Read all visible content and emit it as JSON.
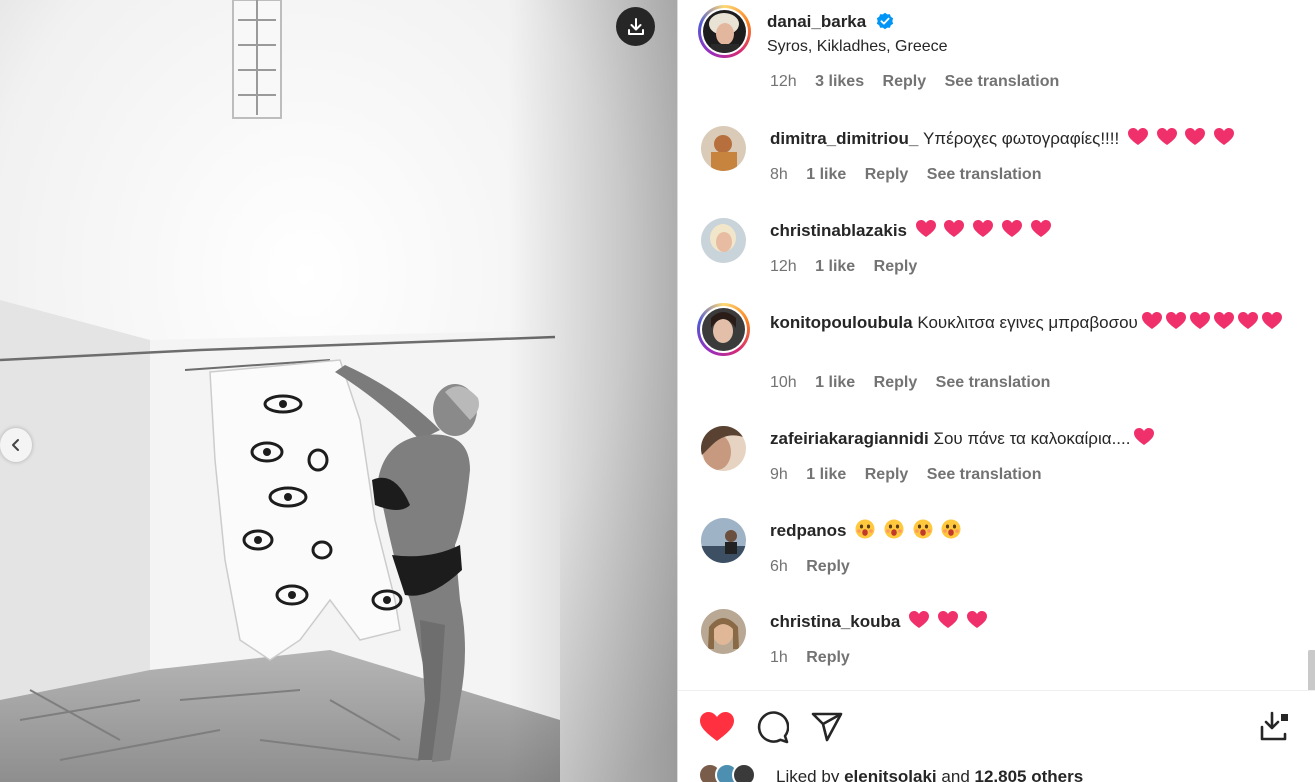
{
  "post": {
    "username": "danai_barka",
    "location": "Syros, Kikladhes, Greece"
  },
  "partial_comment": {
    "time": "12h",
    "likes": "3 likes",
    "reply": "Reply",
    "translate": "See translation"
  },
  "comments": [
    {
      "username": "dimitra_dimitriou_",
      "text": "Υπέροχες φωτογραφίες!!!!",
      "hearts": 4,
      "time": "8h",
      "likes": "1 like",
      "reply": "Reply",
      "translate": "See translation"
    },
    {
      "username": "christinablazakis",
      "text": "",
      "hearts": 5,
      "time": "12h",
      "likes": "1 like",
      "reply": "Reply",
      "translate": ""
    },
    {
      "username": "konitopouloubula",
      "text": "Κουκλιτσα εγινες μπραβοσου",
      "hearts": 6,
      "time": "10h",
      "likes": "1 like",
      "reply": "Reply",
      "translate": "See translation"
    },
    {
      "username": "zafeiriakaragiannidi",
      "text": "Σου πάνε τα καλοκαίρια....",
      "hearts": 1,
      "time": "9h",
      "likes": "1 like",
      "reply": "Reply",
      "translate": "See translation"
    },
    {
      "username": "redpanos",
      "text": "",
      "wow": 4,
      "time": "6h",
      "likes": "",
      "reply": "Reply",
      "translate": ""
    },
    {
      "username": "christina_kouba",
      "text": "",
      "hearts": 3,
      "time": "1h",
      "likes": "",
      "reply": "Reply",
      "translate": ""
    }
  ],
  "likes_summary": {
    "prefix": "Liked by",
    "user": "elenitsolaki",
    "middle": "and",
    "others": "12,805 others"
  },
  "icons": {
    "like": "heart-filled-icon",
    "comment": "comment-icon",
    "share": "share-icon",
    "save": "save-icon",
    "download": "download-icon",
    "prev": "chevron-left-icon",
    "verified": "verified-badge-icon"
  },
  "colors": {
    "heart": "#ff3040",
    "verified": "#0095f6",
    "muted": "#737373",
    "text": "#262626"
  }
}
